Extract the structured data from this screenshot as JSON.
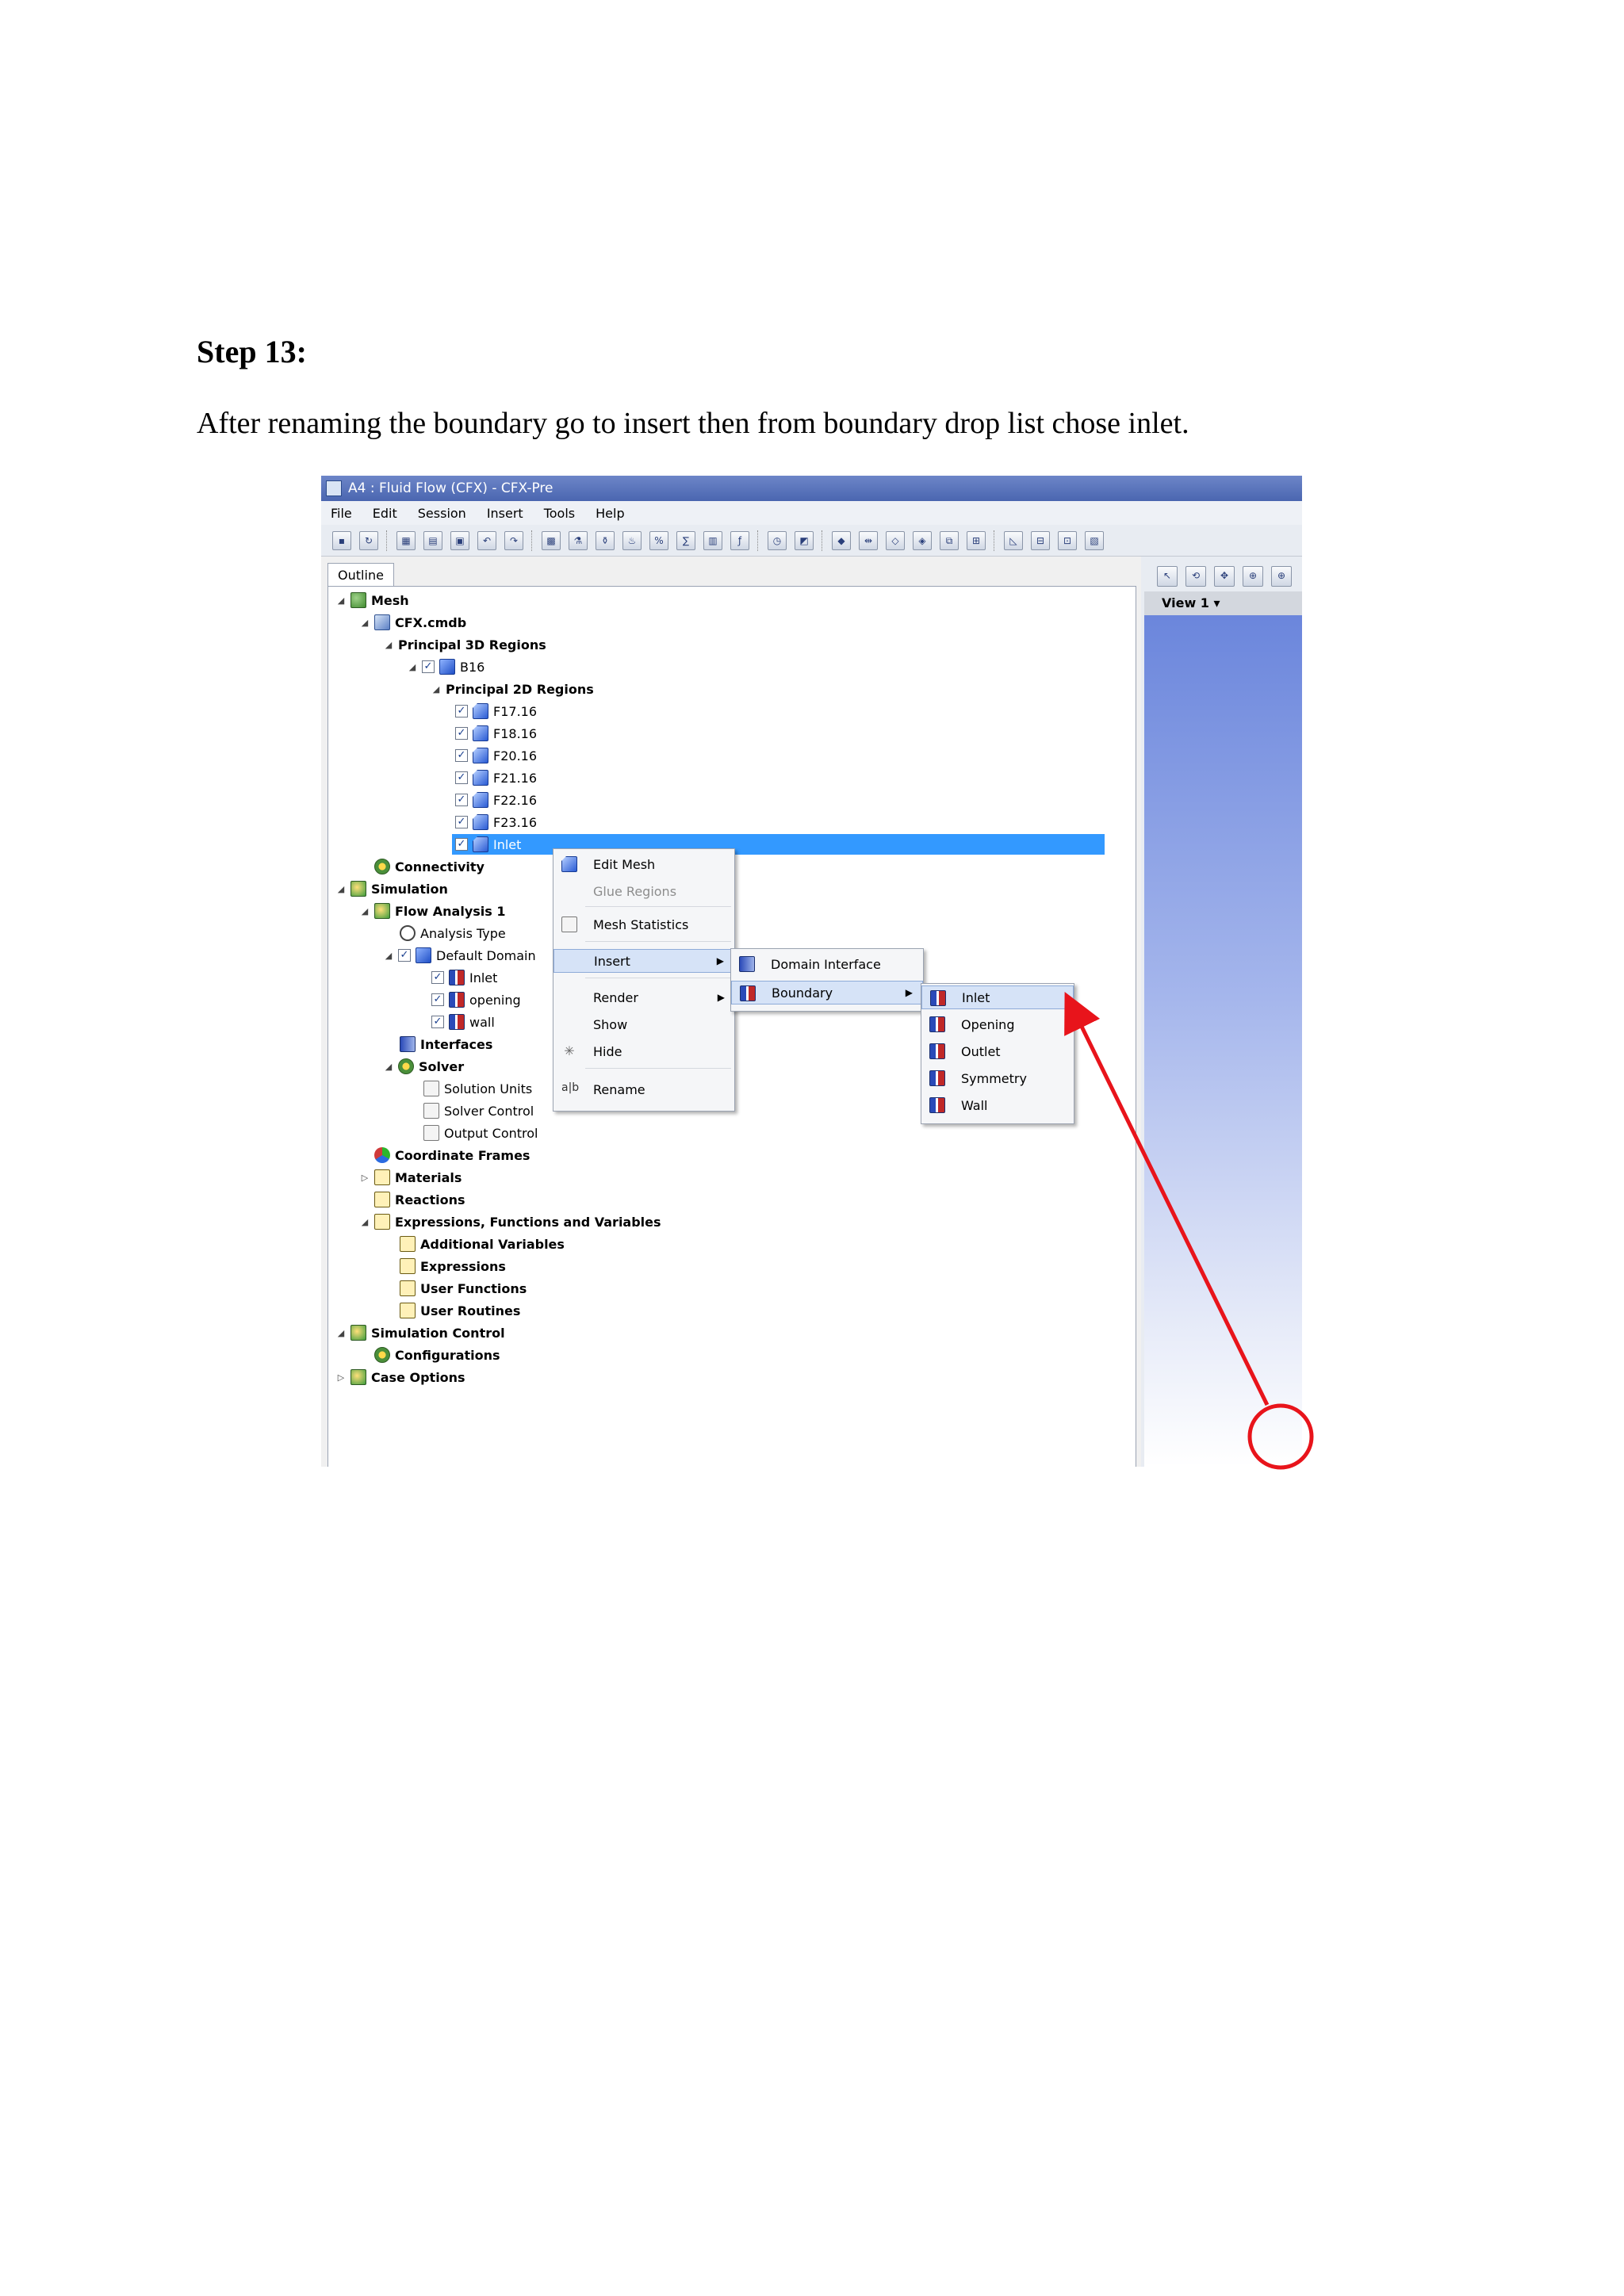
{
  "document": {
    "heading": "Step 13:",
    "instruction": "After renaming the boundary go to insert then from boundary  drop list chose  inlet."
  },
  "window": {
    "title": "A4 : Fluid Flow (CFX) - CFX-Pre"
  },
  "menubar": [
    "File",
    "Edit",
    "Session",
    "Insert",
    "Tools",
    "Help"
  ],
  "outline_tab": "Outline",
  "view": {
    "label": "View 1"
  },
  "tree": {
    "mesh": "Mesh",
    "cfx_cmdb": "CFX.cmdb",
    "principal_3d": "Principal 3D Regions",
    "b16": "B16",
    "principal_2d": "Principal 2D Regions",
    "faces": [
      "F17.16",
      "F18.16",
      "F20.16",
      "F21.16",
      "F22.16",
      "F23.16"
    ],
    "selected": "Inlet",
    "connectivity": "Connectivity",
    "simulation": "Simulation",
    "flow_analysis": "Flow Analysis 1",
    "analysis_type": "Analysis Type",
    "default_domain": "Default Domain",
    "domain_children": [
      "Inlet",
      "opening",
      "wall"
    ],
    "interfaces": "Interfaces",
    "solver": "Solver",
    "solver_children": [
      "Solution Units",
      "Solver Control",
      "Output Control"
    ],
    "coordinate_frames": "Coordinate Frames",
    "materials": "Materials",
    "reactions": "Reactions",
    "expressions_group": "Expressions, Functions and Variables",
    "expr_children": [
      "Additional Variables",
      "Expressions",
      "User Functions",
      "User Routines"
    ],
    "simulation_control": "Simulation Control",
    "configurations": "Configurations",
    "case_options": "Case Options"
  },
  "context_menu": {
    "edit_mesh": "Edit Mesh",
    "glue_regions": "Glue Regions",
    "mesh_statistics": "Mesh Statistics",
    "insert": "Insert",
    "render": "Render",
    "show": "Show",
    "hide": "Hide",
    "rename": "Rename"
  },
  "insert_submenu": {
    "domain_interface": "Domain Interface",
    "boundary": "Boundary"
  },
  "boundary_submenu": [
    "Inlet",
    "Opening",
    "Outlet",
    "Symmetry",
    "Wall"
  ],
  "annotation_color": "#e8141b"
}
